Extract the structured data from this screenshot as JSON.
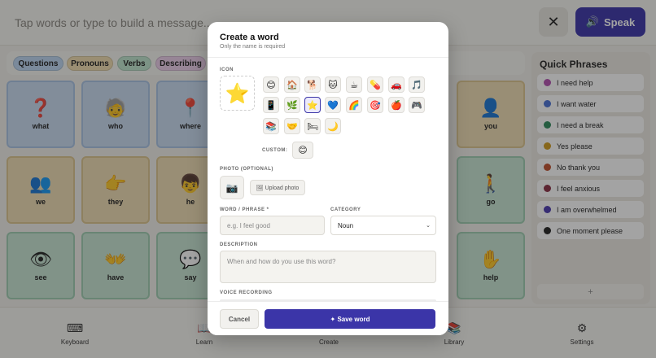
{
  "topbar": {
    "message_placeholder": "Tap words or type to build a message...",
    "close_icon": "✕",
    "speak_icon": "🔊",
    "speak_label": "Speak"
  },
  "categories": [
    {
      "label": "Questions",
      "color": "#bcd6f2"
    },
    {
      "label": "Pronouns",
      "color": "#f1ddb0"
    },
    {
      "label": "Verbs",
      "color": "#bfe4cd"
    },
    {
      "label": "Describing",
      "color": "#eccdea"
    }
  ],
  "tiles": [
    {
      "label": "what",
      "icon": "❓"
    },
    {
      "label": "who",
      "icon": "🧓"
    },
    {
      "label": "where",
      "icon": "📍"
    },
    {
      "label": "you",
      "icon": "👤"
    },
    {
      "label": "we",
      "icon": "👥"
    },
    {
      "label": "they",
      "icon": "👉"
    },
    {
      "label": "he",
      "icon": "👦"
    },
    {
      "label": "go",
      "icon": "🚶"
    },
    {
      "label": "see",
      "icon": "👁"
    },
    {
      "label": "have",
      "icon": "👐"
    },
    {
      "label": "say",
      "icon": "💬"
    },
    {
      "label": "help",
      "icon": "✋"
    }
  ],
  "quick_phrases": {
    "title": "Quick Phrases",
    "add_label": "+",
    "items": [
      {
        "text": "I need help",
        "color": "#b24fb0"
      },
      {
        "text": "I want water",
        "color": "#4a72d6"
      },
      {
        "text": "I need a break",
        "color": "#2f8a5c"
      },
      {
        "text": "Yes please",
        "color": "#d19c1e"
      },
      {
        "text": "No thank you",
        "color": "#c0502e"
      },
      {
        "text": "I feel anxious",
        "color": "#8a2f45"
      },
      {
        "text": "I am overwhelmed",
        "color": "#4a3ab0"
      },
      {
        "text": "One moment please",
        "color": "#222222"
      }
    ]
  },
  "bottom_nav": [
    {
      "label": "Keyboard",
      "icon": "⌨"
    },
    {
      "label": "Learn",
      "icon": "📖"
    },
    {
      "label": "Create",
      "icon": "➕"
    },
    {
      "label": "Library",
      "icon": "📚"
    },
    {
      "label": "Settings",
      "icon": "⚙"
    }
  ],
  "modal": {
    "title": "Create a word",
    "subtitle": "Only the name is required",
    "icon_label": "ICON",
    "selected_icon": "⭐",
    "icon_options": [
      "😊",
      "🏠",
      "🐕",
      "🐱",
      "☕",
      "💊",
      "🚗",
      "🎵",
      "📱",
      "🌿",
      "⭐",
      "💙",
      "🌈",
      "🎯",
      "🍎",
      "🎮",
      "📚",
      "🤝",
      "🛏",
      "🌙"
    ],
    "custom_label": "CUSTOM:",
    "custom_icon": "😊",
    "photo_label": "PHOTO (OPTIONAL)",
    "photo_icon": "📷",
    "upload_label": "🖼 Upload photo",
    "word_label": "WORD / PHRASE *",
    "word_placeholder": "e.g. I feel good",
    "category_label": "CATEGORY",
    "category_value": "Noun",
    "category_chevron": "⌄",
    "description_label": "DESCRIPTION",
    "description_placeholder": "When and how do you use this word?",
    "voice_label": "VOICE RECORDING",
    "cancel_label": "Cancel",
    "save_label": "✦ Save word"
  }
}
